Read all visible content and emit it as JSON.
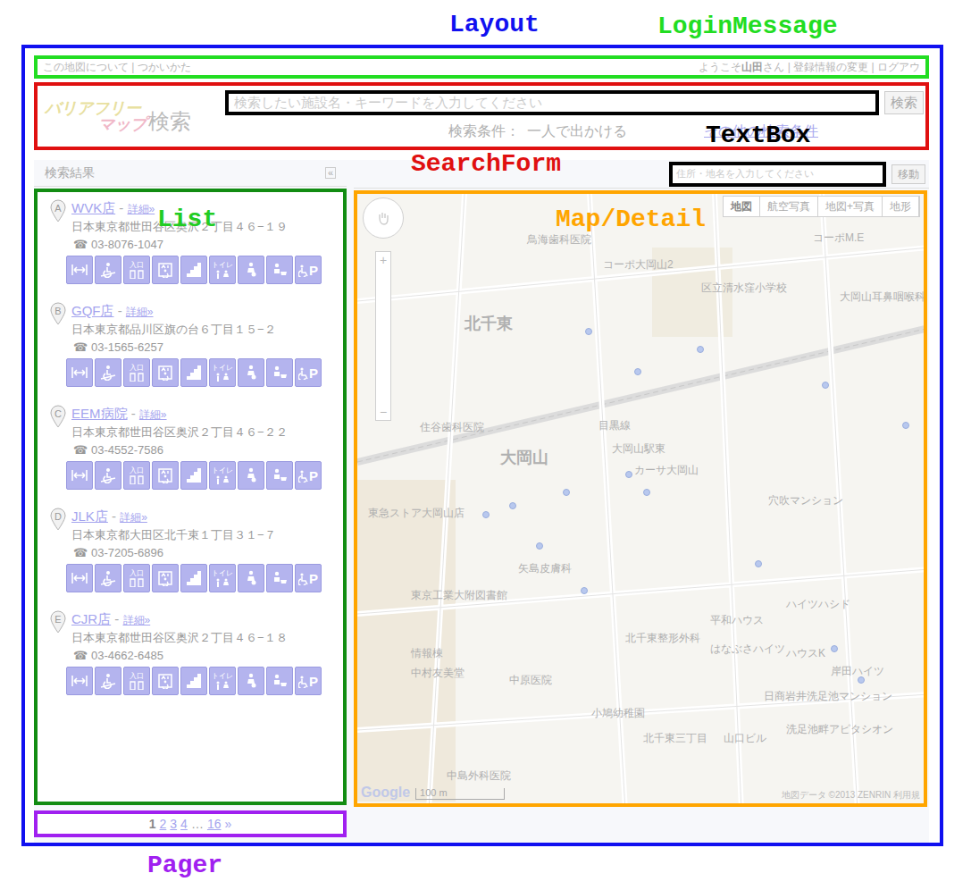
{
  "annotations": {
    "layout": "Layout",
    "login_message": "LoginMessage",
    "search_form": "SearchForm",
    "text_box": "TextBox",
    "list": "List",
    "map_detail": "Map/Detail",
    "pager": "Pager"
  },
  "top_bar": {
    "left": "この地図について | つかいかた",
    "greeting": "ようこそ",
    "user": "山田",
    "suffix": "さん | 登録情報の変更 | ログアウ"
  },
  "search": {
    "logo_top": "バリアフリー",
    "logo_bottom": "マップ",
    "logo_suffix": "検索",
    "placeholder": "検索したい施設名・キーワードを入力してください",
    "button": "検索",
    "condition_label": "検索条件：",
    "condition_value": "一人で出かける",
    "more_link": "その他の検索条件"
  },
  "sidebar": {
    "title": "検索結果",
    "collapse": "«"
  },
  "phone_mark": "☎",
  "detail_link": "詳細»",
  "separator": " - ",
  "results": [
    {
      "marker": "A",
      "name": "WVK店",
      "address": "日本東京都世田谷区奥沢２丁目４６−１９",
      "phone": "03-8076-1047"
    },
    {
      "marker": "B",
      "name": "GQF店",
      "address": "日本東京都品川区旗の台６丁目１５−２",
      "phone": "03-1565-6257"
    },
    {
      "marker": "C",
      "name": "EEM病院",
      "address": "日本東京都世田谷区奥沢２丁目４６−２２",
      "phone": "03-4552-7586"
    },
    {
      "marker": "D",
      "name": "JLK店",
      "address": "日本東京都大田区北千束１丁目３１−７",
      "phone": "03-7205-6896"
    },
    {
      "marker": "E",
      "name": "CJR店",
      "address": "日本東京都世田谷区奥沢２丁目４６−１８",
      "phone": "03-4662-6485"
    }
  ],
  "icons": [
    {
      "kind": "width",
      "label": ""
    },
    {
      "kind": "ramp",
      "label": ""
    },
    {
      "kind": "entrance",
      "label": "入口"
    },
    {
      "kind": "elevator",
      "label": ""
    },
    {
      "kind": "stairs",
      "label": ""
    },
    {
      "kind": "toilet",
      "label": "トイレ"
    },
    {
      "kind": "nursery",
      "label": ""
    },
    {
      "kind": "baby",
      "label": ""
    },
    {
      "kind": "parking",
      "label": "P"
    }
  ],
  "pager": {
    "pages": [
      {
        "label": "1",
        "selected": true
      },
      {
        "label": "2",
        "selected": false
      },
      {
        "label": "3",
        "selected": false
      },
      {
        "label": "4",
        "selected": false
      }
    ],
    "ellipsis": "…",
    "last": "16",
    "next": "»"
  },
  "map": {
    "search_placeholder": "住所・地名を入力してください",
    "go_button": "移動",
    "types": [
      {
        "label": "地図",
        "selected": true
      },
      {
        "label": "航空写真",
        "selected": false
      },
      {
        "label": "地図+写真",
        "selected": false
      },
      {
        "label": "地形",
        "selected": false
      }
    ],
    "zoom_in": "+",
    "zoom_out": "−",
    "scale": "100 m",
    "brand": "Google",
    "copyright": "地図データ ©2013 ZENRIN 利用規",
    "labels": [
      "鳥海歯科医院",
      "コーポ大岡山2",
      "区立清水窪小学校",
      "大岡山耳鼻咽喉科",
      "コーポM.E",
      "北千東",
      "住谷歯科医院",
      "目黒線",
      "大岡山",
      "大岡山駅東",
      "カーサ大岡山",
      "穴吹マンション",
      "東急ストア大岡山店",
      "矢島皮膚科",
      "東京工業大附図書館",
      "平和ハウス",
      "ハイツハシド",
      "北千東整形外科",
      "はなぶさハイツ",
      "ハウスK",
      "岸田ハイツ",
      "情報棟",
      "中村友美堂",
      "中原医院",
      "日商岩井洗足池マンション",
      "小鳩幼稚園",
      "北千東三丁目",
      "山口ビル",
      "洗足池畔アピタシオン",
      "中島外科医院"
    ]
  }
}
